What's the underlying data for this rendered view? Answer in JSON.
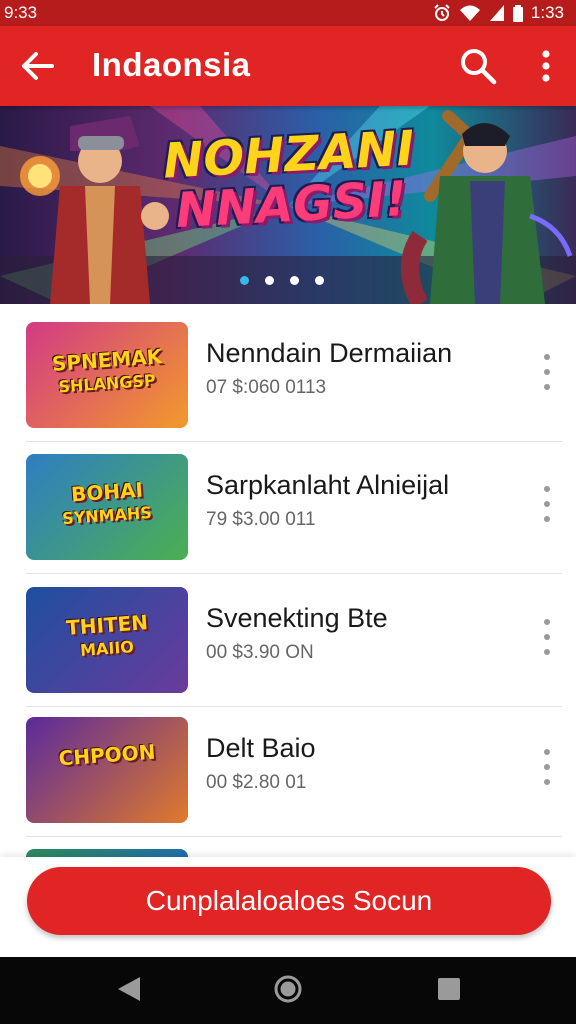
{
  "status_bar": {
    "time_left": "9:33",
    "time_right": "1:33"
  },
  "app_bar": {
    "title": "Indaonsia",
    "back_icon": "arrow-left-icon",
    "search_icon": "search-icon",
    "more_icon": "more-vert-icon"
  },
  "banner": {
    "title_line1": "NOHZANI",
    "title_line2": "NNAGSI!",
    "page_count": 4,
    "active_page": 1
  },
  "games": [
    {
      "title": "Nenndain Dermaiian",
      "subtitle": "07 $:060 0113",
      "thumb_text_1": "SPNEMAK",
      "thumb_text_2": "SHLANGSP",
      "thumb_colors": [
        "#d23a86",
        "#f29a2b"
      ]
    },
    {
      "title": "Sarpkanlaht Alnieijal",
      "subtitle": "79 $3.00 011",
      "thumb_text_1": "BOHAI",
      "thumb_text_2": "SYNMAHS",
      "thumb_colors": [
        "#2f7ec4",
        "#4caf50"
      ]
    },
    {
      "title": "Svenekting Bte",
      "subtitle": "00 $3.90 ON",
      "thumb_text_1": "THITEN",
      "thumb_text_2": "MAIIO",
      "thumb_colors": [
        "#1e4fa0",
        "#6a3b9c"
      ]
    },
    {
      "title": "Delt Baio",
      "subtitle": "00 $2.80 01",
      "thumb_text_1": "CHPOON",
      "thumb_text_2": "",
      "thumb_colors": [
        "#5a2a9c",
        "#e07a2b"
      ]
    }
  ],
  "cta": {
    "label": "Cunplalaloaloes Socun"
  }
}
